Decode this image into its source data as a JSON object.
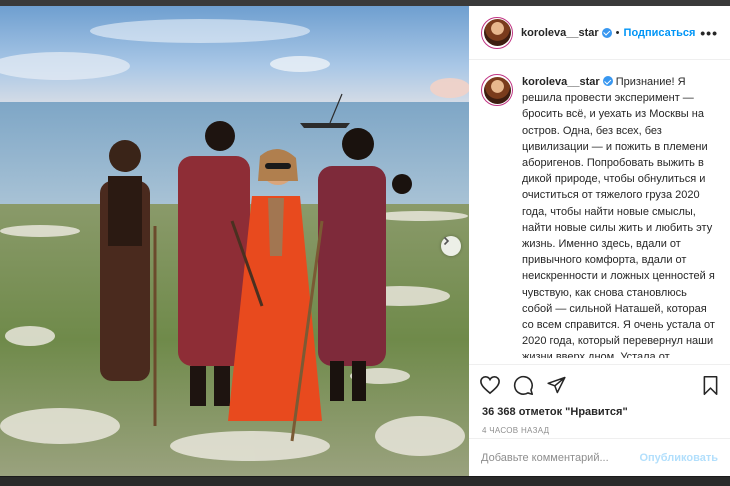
{
  "post": {
    "username": "koroleva__star",
    "separator": "•",
    "follow_label": "Подписаться",
    "more_label": "•••",
    "caption": "Признание! Я решила провести эксперимент — бросить всё, и уехать из Москвы на остров. Одна, без всех, без цивилизации — и пожить в племени аборигенов. Попробовать выжить в дикой природе, чтобы обнулиться и очиститься от тяжелого груза 2020 года, чтобы найти новые смыслы, найти новые силы жить и любить эту жизнь. Именно здесь, вдали от привычного комфорта, вдали от неискренности и ложных ценностей я чувствую, как снова становлюсь собой — сильной Наташей, которая со всем справится. Я очень устала от 2020 года, который перевернул наши жизни вверх дном. Устала от сфабрикованных скандалов, предательств «друзей», ошибок",
    "likes": "36 368 отметок \"Нравится\"",
    "time": "4 ЧАСОВ НАЗАД",
    "comment_placeholder": "Добавьте комментарий...",
    "publish_label": "Опубликовать"
  },
  "icons": {
    "like": "heart-icon",
    "comment": "comment-icon",
    "share": "share-icon",
    "save": "bookmark-icon",
    "verified": "verified-badge-icon",
    "next": "chevron-right-icon"
  },
  "colors": {
    "link": "#0095f6",
    "publish_disabled": "#b2dffc",
    "verified": "#3897f0",
    "dress": "#e84a1e"
  }
}
